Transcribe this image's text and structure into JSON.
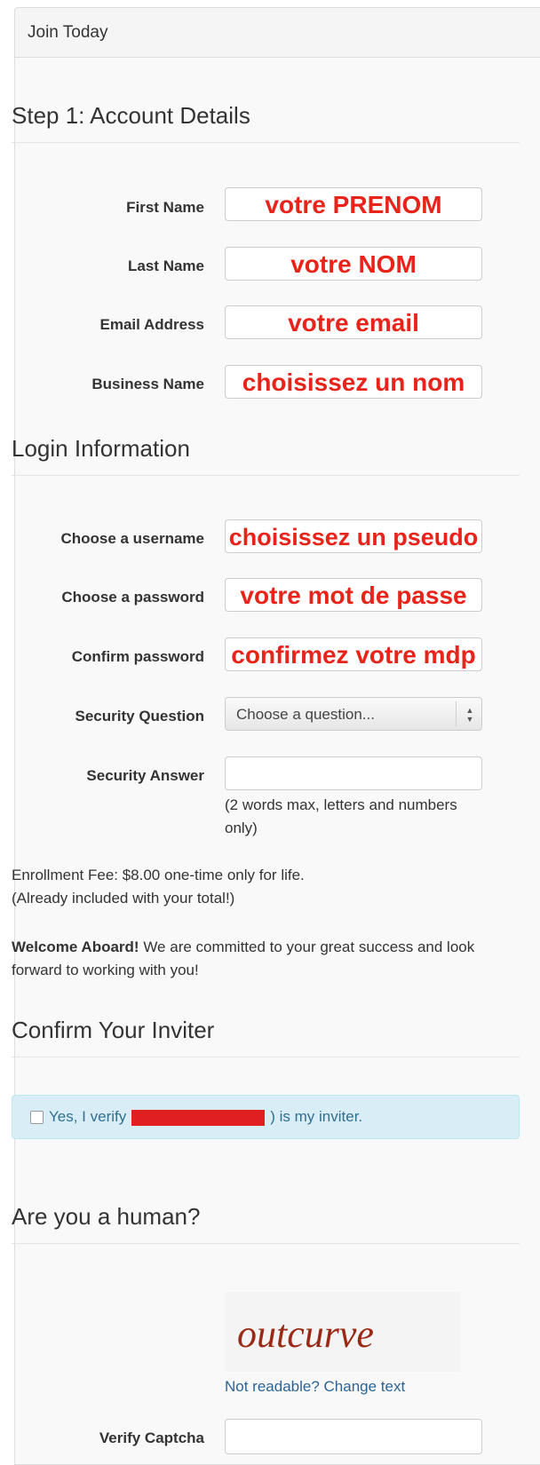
{
  "panel": {
    "title": "Join Today"
  },
  "step1": {
    "title": "Step 1: Account Details",
    "fields": [
      {
        "label": "First Name",
        "value": "votre PRENOM"
      },
      {
        "label": "Last Name",
        "value": "votre NOM"
      },
      {
        "label": "Email Address",
        "value": "votre email"
      },
      {
        "label": "Business Name",
        "value": "choisissez un nom"
      }
    ]
  },
  "login": {
    "title": "Login Information",
    "fields": [
      {
        "label": "Choose a username",
        "value": "choisissez un pseudo"
      },
      {
        "label": "Choose a password",
        "value": "votre mot de passe"
      },
      {
        "label": "Confirm password",
        "value": "confirmez votre mdp"
      }
    ],
    "security_question": {
      "label": "Security Question",
      "selected": "Choose a question..."
    },
    "security_answer": {
      "label": "Security Answer",
      "value": "",
      "help": "(2 words max, letters and numbers only)"
    }
  },
  "enrollment": {
    "line1": "Enrollment Fee: $8.00 one-time only for life.",
    "line2": "(Already included with your total!)"
  },
  "welcome": {
    "bold": "Welcome Aboard!",
    "text": " We are committed to your great success and look forward to working with you!"
  },
  "inviter": {
    "title": "Confirm Your Inviter",
    "verify_prefix": "Yes, I verify",
    "verify_suffix": ") is my inviter."
  },
  "human": {
    "title": "Are you a human?",
    "captcha_text": "outcurve",
    "change_link": "Not readable? Change text",
    "verify_label": "Verify Captcha",
    "verify_value": ""
  },
  "colors": {
    "placeholder_red": "#e8231a",
    "alert_bg": "#d9edf7",
    "alert_text": "#31708f"
  }
}
